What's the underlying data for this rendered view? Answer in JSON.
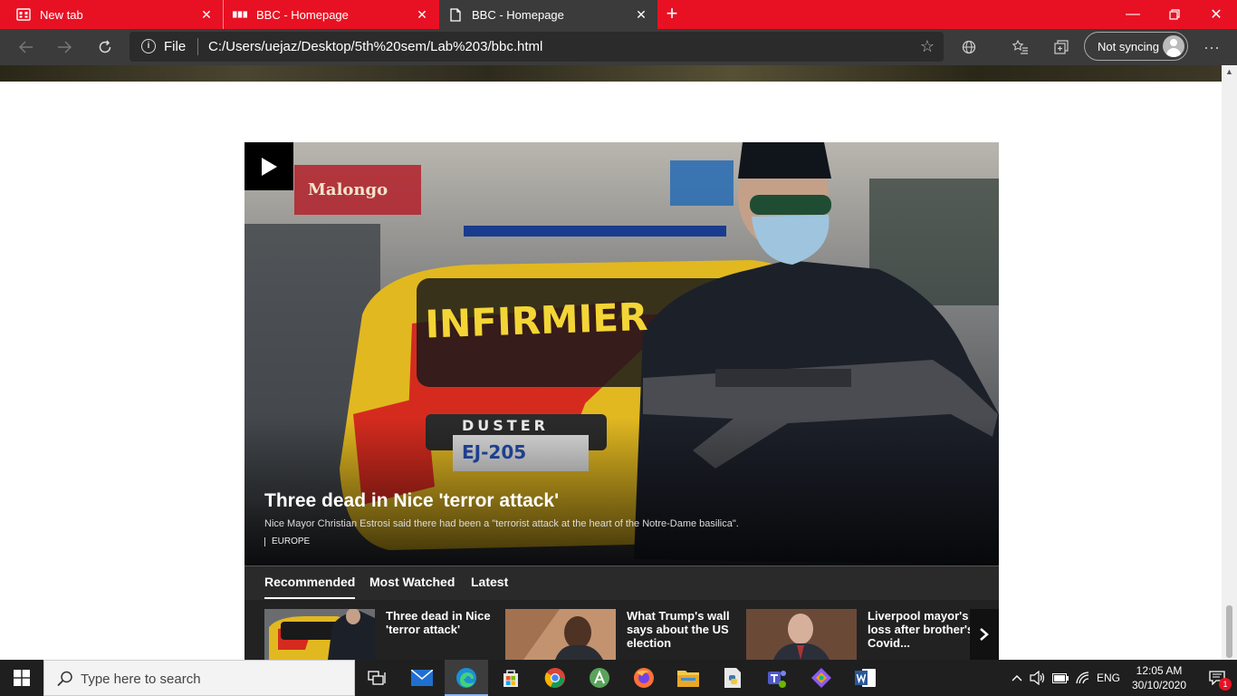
{
  "browser": {
    "tabs": [
      {
        "title": "New tab",
        "icon": "newtab-grid-icon"
      },
      {
        "title": "BBC - Homepage",
        "icon": "bbc-icon"
      },
      {
        "title": "BBC - Homepage",
        "icon": "page-icon",
        "active": true
      }
    ],
    "address": {
      "scheme_label": "File",
      "url": "C:/Users/uejaz/Desktop/5th%20sem/Lab%203/bbc.html"
    },
    "sync_label": "Not syncing",
    "colors": {
      "tabstrip": "#e81123",
      "toolbar": "#3b3b3b"
    }
  },
  "page": {
    "hero": {
      "title": "Three dead in Nice 'terror attack'",
      "description": "Nice Mayor Christian Estrosi said there had been a \"terrorist attack at the heart of the Notre-Dame basilica\".",
      "category": "EUROPE",
      "image_text": {
        "vehicle": "INFIRMIER",
        "model": "DUSTER",
        "plate": "EJ-205",
        "sign": "Malongo"
      }
    },
    "video_tabs": [
      "Recommended",
      "Most Watched",
      "Latest"
    ],
    "cards": [
      {
        "title": "Three dead in Nice 'terror attack'"
      },
      {
        "title": "What Trump's wall says about the US election"
      },
      {
        "title": "Liverpool mayor's loss after brother's Covid..."
      }
    ]
  },
  "taskbar": {
    "search_placeholder": "Type here to search",
    "language": "ENG",
    "time": "12:05 AM",
    "date": "30/10/2020",
    "notification_count": "1"
  }
}
